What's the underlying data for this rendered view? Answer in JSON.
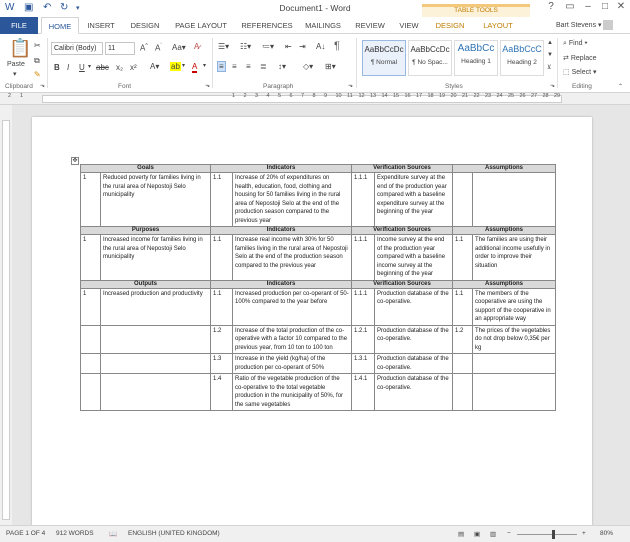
{
  "window": {
    "title": "Document1 - Word",
    "user": "Bart Stevens"
  },
  "tabs": {
    "file": "FILE",
    "home": "HOME",
    "insert": "INSERT",
    "design": "DESIGN",
    "page_layout": "PAGE LAYOUT",
    "references": "REFERENCES",
    "mailings": "MAILINGS",
    "review": "REVIEW",
    "view": "VIEW",
    "table_design": "DESIGN",
    "table_layout": "LAYOUT",
    "table_tools": "TABLE TOOLS"
  },
  "ribbon": {
    "paste": "Paste",
    "font_name": "Calibri (Body)",
    "font_size": "11",
    "groups": {
      "clipboard": "Clipboard",
      "font": "Font",
      "paragraph": "Paragraph",
      "styles": "Styles",
      "editing": "Editing"
    },
    "styles": [
      {
        "preview": "AaBbCcDc",
        "name": "¶ Normal"
      },
      {
        "preview": "AaBbCcDc",
        "name": "¶ No Spac..."
      },
      {
        "preview": "AaBbCc",
        "name": "Heading 1"
      },
      {
        "preview": "AaBbCcC",
        "name": "Heading 2"
      }
    ],
    "editing": {
      "find": "Find",
      "replace": "Replace",
      "select": "Select"
    }
  },
  "ruler_numbers": [
    "1",
    "2",
    "1",
    "2",
    "3",
    "4",
    "5",
    "6",
    "7",
    "8",
    "9",
    "10",
    "11",
    "12",
    "13",
    "14",
    "15",
    "16",
    "17",
    "18",
    "19",
    "20",
    "21",
    "22",
    "23",
    "24",
    "25",
    "26",
    "27",
    "28",
    "29"
  ],
  "table": {
    "sections": [
      {
        "headers": [
          "Goals",
          "Indicators",
          "Verification Sources",
          "Assumptions"
        ],
        "rows": [
          {
            "n": "1",
            "desc": "Reduced poverty for families living in the rural area of Nepostoji Selo municipality",
            "ind_n": "1.1",
            "ind": "Increase of 20% of expenditures on health, education, food, clothing and housing for 50 families living in the rural area of Nepostoji Selo at the end of the production season compared to the previous year",
            "ver_n": "1.1.1",
            "ver": "Expenditure survey at the end of the production year compared with a baseline expenditure survey at the beginning of the year",
            "as_n": "",
            "as": ""
          }
        ]
      },
      {
        "headers": [
          "Purposes",
          "Indicators",
          "Verification Sources",
          "Assumptions"
        ],
        "rows": [
          {
            "n": "1",
            "desc": "Increased income for families living in the rural area of Nepostoji Selo municipality",
            "ind_n": "1.1",
            "ind": "Increase real income with 30% for 50 families living in the rural area of Nepostoji Selo at the end of the production season compared to the previous year",
            "ver_n": "1.1.1",
            "ver": "Income survey at the end of the production year compared with a baseline income survey at the beginning of the year",
            "as_n": "1.1",
            "as": "The families are using their additional income usefully in order to improve their situation"
          }
        ]
      },
      {
        "headers": [
          "Outputs",
          "Indicators",
          "Verification Sources",
          "Assumptions"
        ],
        "rows": [
          {
            "n": "1",
            "desc": "Increased production and productivity",
            "ind_n": "1.1",
            "ind": "Increased production per co-operant of 50-100% compared to the year before",
            "ver_n": "1.1.1",
            "ver": "Production database of the co-operative.",
            "as_n": "1.1",
            "as": "The members of the cooperative are using the support of the cooperative in an appropriate way"
          },
          {
            "n": "",
            "desc": "",
            "ind_n": "1.2",
            "ind": "Increase of the total production of the co-operative with a factor 10 compared to the previous year, from 10 ton to 100 ton",
            "ver_n": "1.2.1",
            "ver": "Production database of the co-operative.",
            "as_n": "1.2",
            "as": "The prices of the vegetables do not drop below 0,35€ per kg"
          },
          {
            "n": "",
            "desc": "",
            "ind_n": "1.3",
            "ind": "Increase in the yield (kg/ha) of the production per co-operant of 50%",
            "ver_n": "1.3.1",
            "ver": "Production database of the co-operative.",
            "as_n": "",
            "as": ""
          },
          {
            "n": "",
            "desc": "",
            "ind_n": "1.4",
            "ind": "Ratio of the vegetable production of the co-operative to the total vegetable production in the municipality of 50%, for the same vegetables",
            "ver_n": "1.4.1",
            "ver": "Production database of the co-operative.",
            "as_n": "",
            "as": ""
          }
        ]
      }
    ]
  },
  "status": {
    "page": "PAGE 1 OF 4",
    "words": "912 WORDS",
    "language": "ENGLISH (UNITED KINGDOM)",
    "zoom": "80%"
  }
}
